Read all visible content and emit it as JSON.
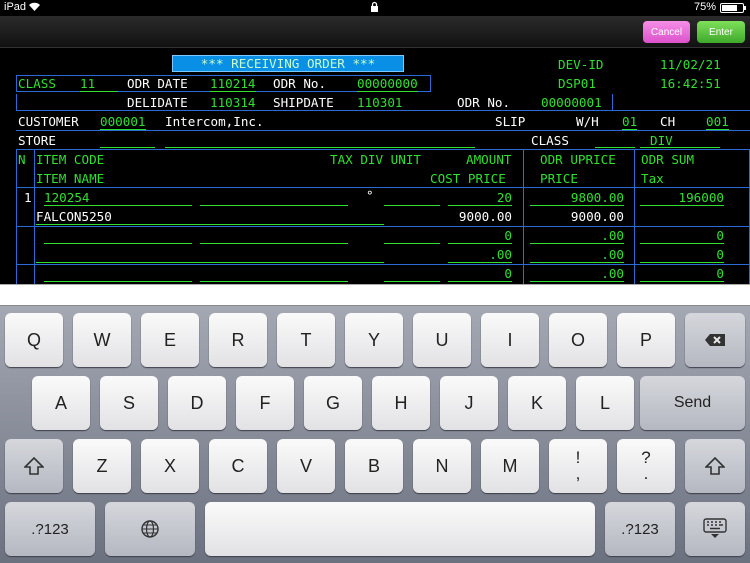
{
  "status": {
    "carrier": "iPad",
    "battery": "75%",
    "battery_level": 0.75
  },
  "toolbar": {
    "cancel": "Cancel",
    "enter": "Enter"
  },
  "form": {
    "title": "*** RECEIVING ORDER ***",
    "dev_id_label": "DEV-ID",
    "date": "11/02/21",
    "dsp": "DSP01",
    "time": "16:42:51",
    "class_label": "CLASS",
    "class_value": "11",
    "odr_date_label": "ODR DATE",
    "odr_date": "110214",
    "odr_no_label": "ODR No.",
    "odr_no": "00000000",
    "delidate_label": "DELIDATE",
    "delidate": "110314",
    "shipdate_label": "SHIPDATE",
    "shipdate": "110301",
    "odr_no2_label": "ODR No.",
    "odr_no2": "00000001",
    "customer_label": "CUSTOMER",
    "customer_code": "000001",
    "customer_name": "Intercom,Inc.",
    "slip_label": "SLIP",
    "wh_label": "W/H",
    "wh": "01",
    "ch_label": "CH",
    "ch": "001",
    "store_label": "STORE",
    "class2_label": "CLASS",
    "div_label": "DIV",
    "headers": {
      "n": "N",
      "item_code": "ITEM CODE",
      "tax_div_unit": "TAX DIV UNIT",
      "amount": "AMOUNT",
      "odr_uprice": "ODR UPRICE",
      "odr_sum": "ODR SUM",
      "item_name": "ITEM NAME",
      "cost_price": "COST PRICE",
      "price": "PRICE",
      "tax": "Tax"
    },
    "rows": [
      {
        "n": "1",
        "code": "120254",
        "tax": "°",
        "amount": "20",
        "uprice": "9800.00",
        "sum": "196000",
        "name": "FALCON5250",
        "cost": "9000.00",
        "price": "9000.00",
        "tax_amt": ""
      },
      {
        "n": "",
        "code": "",
        "tax": "",
        "amount": "0",
        "uprice": ".00",
        "sum": "0",
        "name": "",
        "cost": ".00",
        "price": ".00",
        "tax_amt": "0"
      },
      {
        "n": "",
        "code": "",
        "tax": "",
        "amount": "0",
        "uprice": ".00",
        "sum": "0"
      }
    ]
  },
  "keyboard": {
    "row1": [
      "Q",
      "W",
      "E",
      "R",
      "T",
      "Y",
      "U",
      "I",
      "O",
      "P"
    ],
    "row2": [
      "A",
      "S",
      "D",
      "F",
      "G",
      "H",
      "J",
      "K",
      "L"
    ],
    "send": "Send",
    "row3": [
      "Z",
      "X",
      "C",
      "V",
      "B",
      "N",
      "M"
    ],
    "excl_top": "!",
    "excl_bottom": ",",
    "q_top": "?",
    "q_bottom": ".",
    "num_left": ".?123",
    "num_right": ".?123"
  }
}
